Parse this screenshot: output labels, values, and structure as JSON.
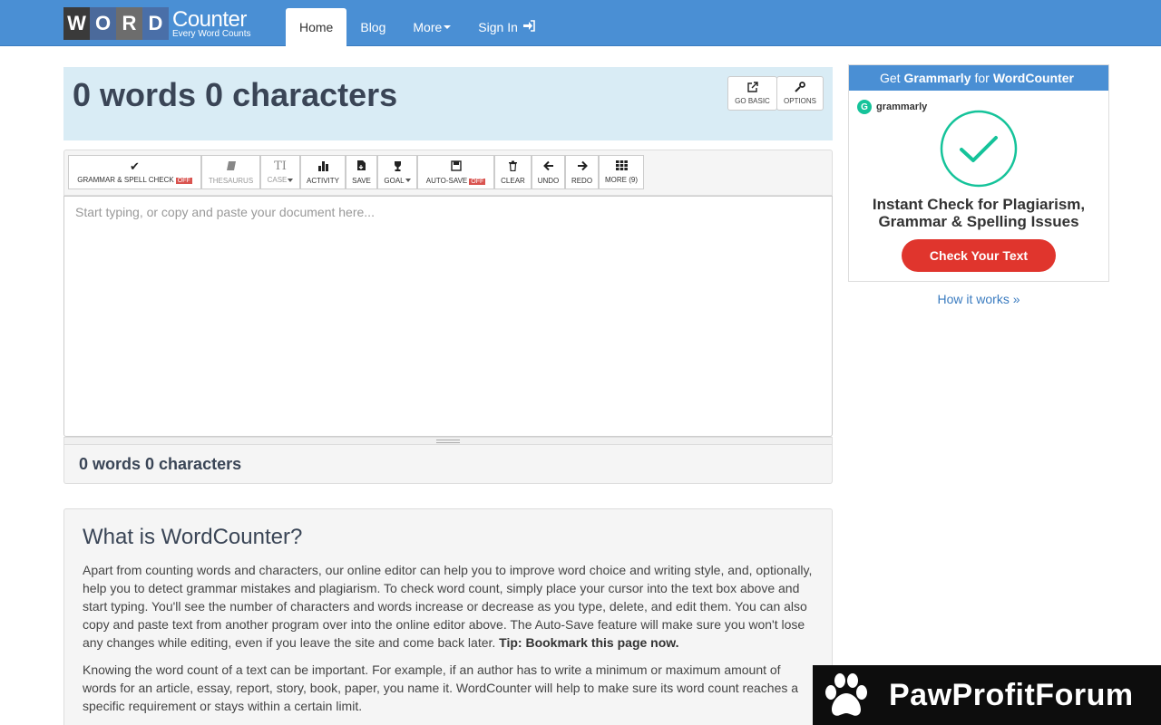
{
  "navbar": {
    "logo": {
      "letters": [
        "W",
        "O",
        "R",
        "D"
      ],
      "title": "Counter",
      "tagline": "Every Word Counts"
    },
    "items": [
      {
        "label": "Home",
        "active": true
      },
      {
        "label": "Blog"
      },
      {
        "label": "More"
      },
      {
        "label": "Sign In",
        "icon": "sign-in-icon"
      }
    ]
  },
  "counter": {
    "title": "0 words 0 characters",
    "go_basic": {
      "label": "GO BASIC",
      "icon": "external-link-icon"
    },
    "options": {
      "label": "OPTIONS",
      "icon": "wrench-icon"
    }
  },
  "toolbar": {
    "grammar": {
      "label": "GRAMMAR & SPELL CHECK",
      "badge": "OFF",
      "icon": "check-icon"
    },
    "thesaurus": {
      "label": "THESAURUS",
      "icon": "book-icon"
    },
    "case": {
      "label": "CASE",
      "icon": "text-case-icon"
    },
    "activity": {
      "label": "ACTIVITY",
      "icon": "bar-chart-icon"
    },
    "save": {
      "label": "SAVE",
      "icon": "file-save-icon"
    },
    "goal": {
      "label": "GOAL",
      "icon": "trophy-icon"
    },
    "autosave": {
      "label": "AUTO-SAVE",
      "badge": "OFF",
      "icon": "floppy-icon"
    },
    "clear": {
      "label": "CLEAR",
      "icon": "trash-icon"
    },
    "undo": {
      "label": "UNDO",
      "icon": "arrow-left-icon"
    },
    "redo": {
      "label": "REDO",
      "icon": "arrow-right-icon"
    },
    "more": {
      "label": "MORE (9)",
      "icon": "grid-icon"
    }
  },
  "editor": {
    "placeholder": "Start typing, or copy and paste your document here...",
    "value": ""
  },
  "footer_count": "0 words 0 characters",
  "article": {
    "title": "What is WordCounter?",
    "p1": "Apart from counting words and characters, our online editor can help you to improve word choice and writing style, and, optionally, help you to detect grammar mistakes and plagiarism. To check word count, simply place your cursor into the text box above and start typing. You'll see the number of characters and words increase or decrease as you type, delete, and edit them. You can also copy and paste text from another program over into the online editor above. The Auto-Save feature will make sure you won't lose any changes while editing, even if you leave the site and come back later.",
    "p1_tip": "Tip: Bookmark this page now.",
    "p2": "Knowing the word count of a text can be important. For example, if an author has to write a minimum or maximum amount of words for an article, essay, report, story, book, paper, you name it. WordCounter will help to make sure its word count reaches a specific requirement or stays within a certain limit."
  },
  "ad": {
    "head_pre": "Get",
    "head_brand": "Grammarly",
    "head_mid": "for",
    "head_site": "WordCounter",
    "brand_logo": "grammarly",
    "headline_1": "Instant Check for Plagiarism,",
    "headline_2": "Grammar & Spelling Issues",
    "button": "Check Your Text",
    "accent": "#15c39a",
    "button_color": "#e0352d"
  },
  "how_it_works": "How it works »",
  "watermark": "PawProfitForum",
  "colors": {
    "nav": "#4a8fd4",
    "title_panel": "#d9ecf5",
    "badge": "#d9534f"
  }
}
